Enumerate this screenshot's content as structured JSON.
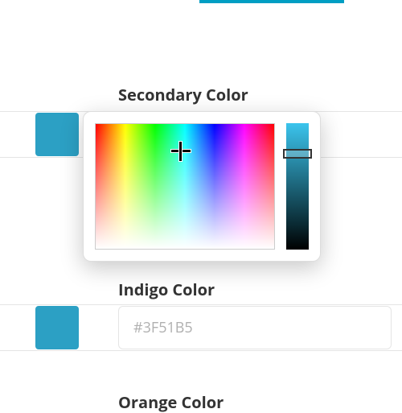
{
  "sections": {
    "secondary": {
      "title": "Secondary Color"
    },
    "indigo": {
      "title": "Indigo Color",
      "hex": "#3F51B5"
    },
    "orange": {
      "title": "Orange Color"
    }
  },
  "swatch_color": "#2ca0c4"
}
